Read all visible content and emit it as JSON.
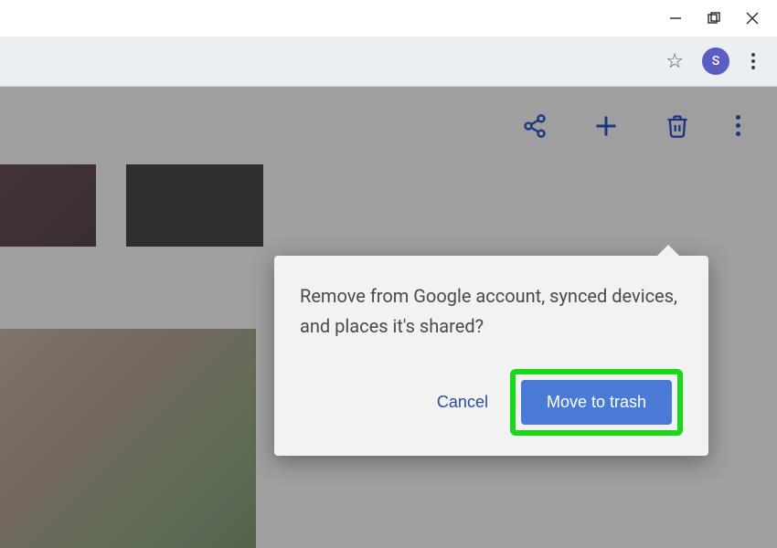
{
  "window": {
    "avatar_initial": "S"
  },
  "dialog": {
    "message": "Remove from Google account, synced devices, and places it's shared?",
    "cancel_label": "Cancel",
    "confirm_label": "Move to trash"
  },
  "colors": {
    "toolbar_icon": "#1a3680",
    "primary_button": "#4a7ad6",
    "highlight": "#18d818"
  }
}
